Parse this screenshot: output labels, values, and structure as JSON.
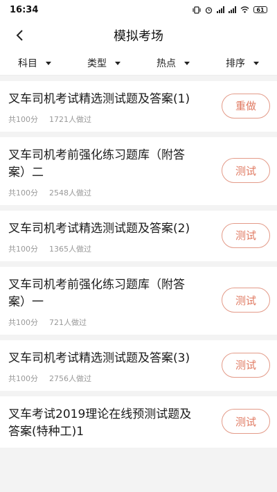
{
  "status_bar": {
    "time": "16:34",
    "battery": "61"
  },
  "header": {
    "title": "模拟考场"
  },
  "filters": [
    {
      "label": "科目"
    },
    {
      "label": "类型"
    },
    {
      "label": "热点"
    },
    {
      "label": "排序"
    }
  ],
  "items": [
    {
      "title": "叉车司机考试精选测试题及答案(1)",
      "score": "共100分",
      "count": "1721人做过",
      "action": "重做"
    },
    {
      "title": "叉车司机考前强化练习题库（附答案）二",
      "score": "共100分",
      "count": "2548人做过",
      "action": "测试"
    },
    {
      "title": "叉车司机考试精选测试题及答案(2)",
      "score": "共100分",
      "count": "1365人做过",
      "action": "测试"
    },
    {
      "title": "叉车司机考前强化练习题库（附答案）一",
      "score": "共100分",
      "count": "721人做过",
      "action": "测试"
    },
    {
      "title": "叉车司机考试精选测试题及答案(3)",
      "score": "共100分",
      "count": "2756人做过",
      "action": "测试"
    },
    {
      "title": "叉车考试2019理论在线预测试题及答案(特种工)1",
      "score": "",
      "count": "",
      "action": "测试"
    }
  ]
}
